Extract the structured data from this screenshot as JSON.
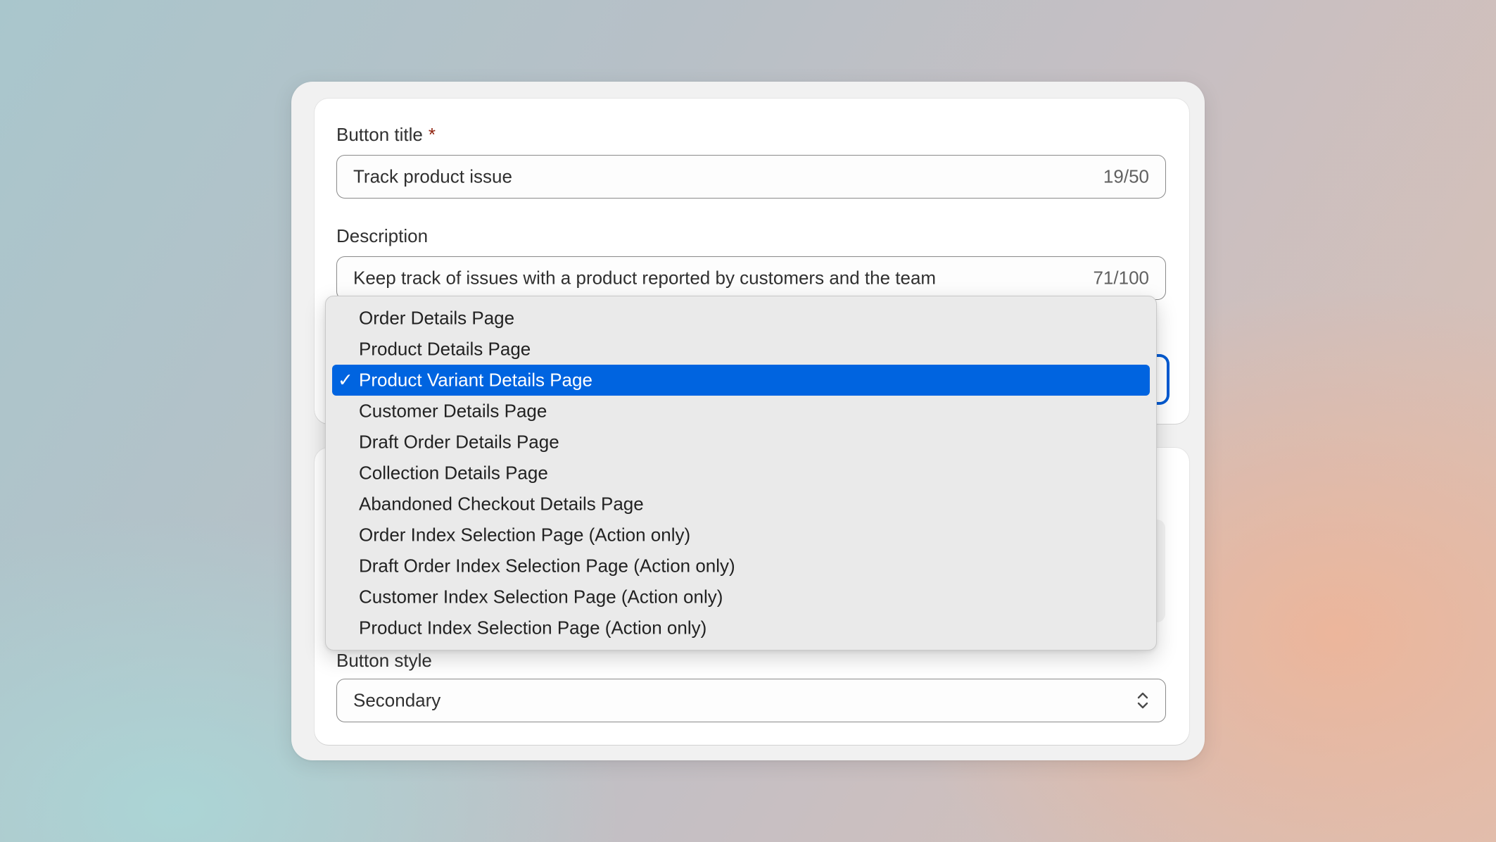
{
  "button_title": {
    "label": "Button title",
    "required_marker": "*",
    "value": "Track product issue",
    "counter": "19/50"
  },
  "description": {
    "label": "Description",
    "value": "Keep track of issues with a product reported by customers and the team",
    "counter": "71/100"
  },
  "target_dropdown": {
    "selected_index": 2,
    "check_glyph": "✓",
    "options": [
      "Order Details Page",
      "Product Details Page",
      "Product Variant Details Page",
      "Customer Details Page",
      "Draft Order Details Page",
      "Collection Details Page",
      "Abandoned Checkout Details Page",
      "Order Index Selection Page (Action only)",
      "Draft Order Index Selection Page (Action only)",
      "Customer Index Selection Page (Action only)",
      "Product Index Selection Page (Action only)"
    ]
  },
  "button_style": {
    "label": "Button style",
    "value": "Secondary",
    "icon": "select-chevrons-icon"
  },
  "colors": {
    "accent": "#005bd3",
    "menu_highlight": "#0064e0",
    "required": "#8e1f0b"
  }
}
